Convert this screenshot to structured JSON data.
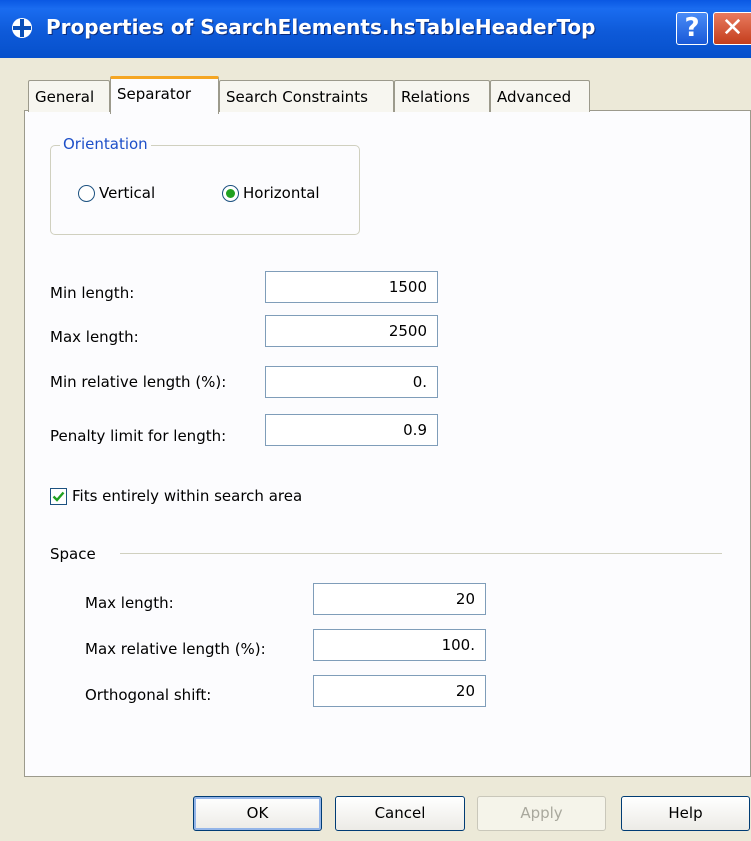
{
  "window": {
    "title": "Properties of SearchElements.hsTableHeaderTop",
    "help_glyph": "?",
    "close_glyph": "✕"
  },
  "tabs": [
    {
      "label": "General"
    },
    {
      "label": "Separator"
    },
    {
      "label": "Search Constraints"
    },
    {
      "label": "Relations"
    },
    {
      "label": "Advanced"
    }
  ],
  "orientation": {
    "legend": "Orientation",
    "options": [
      {
        "label": "Vertical",
        "checked": false
      },
      {
        "label": "Horizontal",
        "checked": true
      }
    ]
  },
  "fields": [
    {
      "label": "Min length:",
      "value": "1500"
    },
    {
      "label": "Max length:",
      "value": "2500"
    },
    {
      "label": "Min relative length (%):",
      "value": "0."
    },
    {
      "label": "Penalty limit for length:",
      "value": "0.9"
    }
  ],
  "fits_checkbox": {
    "label": "Fits entirely within search area",
    "checked": true
  },
  "space": {
    "heading": "Space",
    "fields": [
      {
        "label": "Max length:",
        "value": "20"
      },
      {
        "label": "Max relative length (%):",
        "value": "100."
      },
      {
        "label": "Orthogonal shift:",
        "value": "20"
      }
    ]
  },
  "buttons": {
    "ok": "OK",
    "cancel": "Cancel",
    "apply": "Apply",
    "help": "Help"
  },
  "colors": {
    "title_bar": "#0a58e3",
    "active_tab_accent": "#f5a623",
    "legend_text": "#1d4fc8",
    "radio_dot": "#21a121",
    "check_mark": "#21a121"
  }
}
